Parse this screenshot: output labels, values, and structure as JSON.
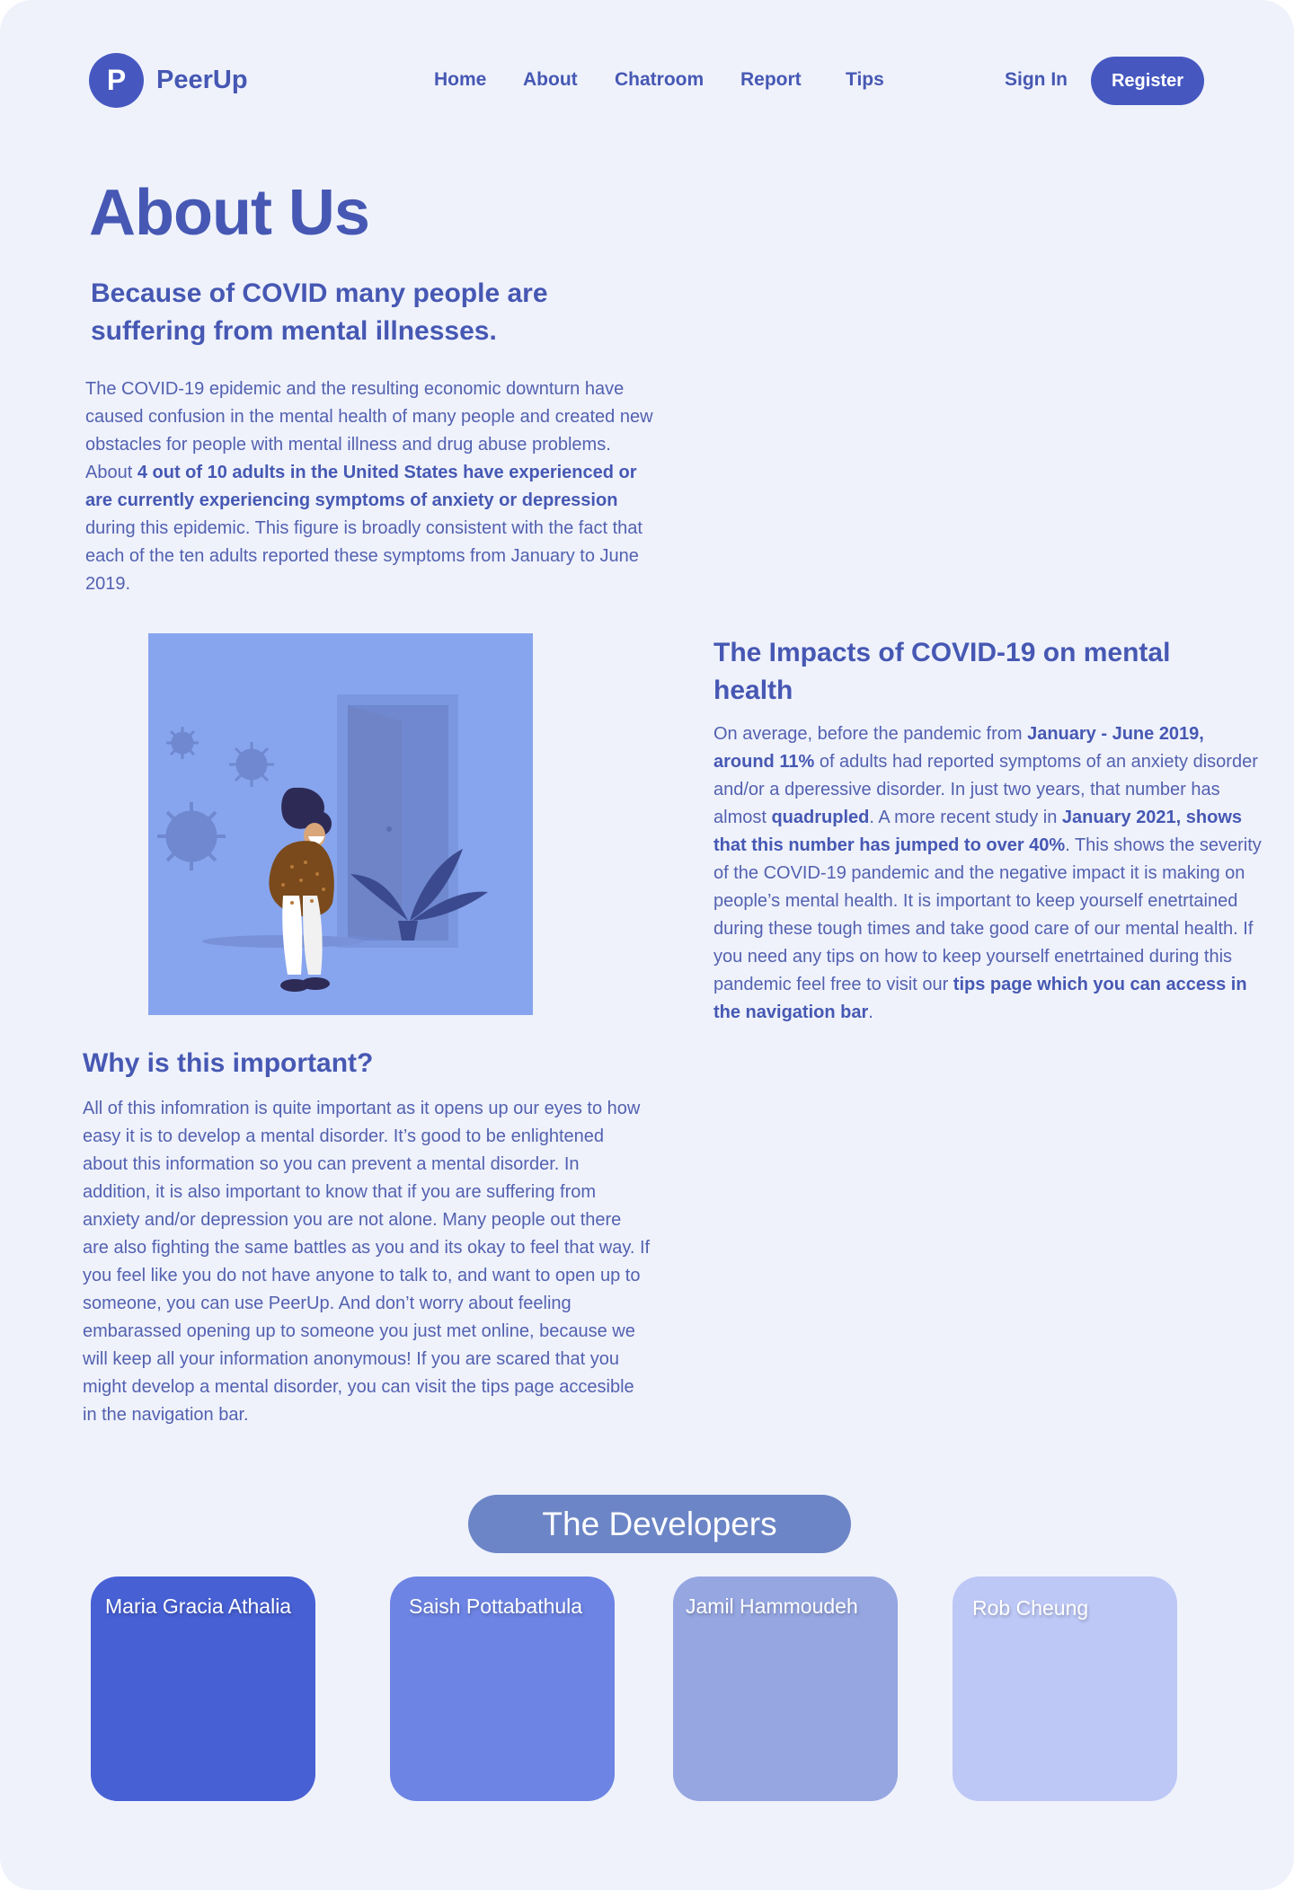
{
  "brand": {
    "logo_letter": "P",
    "name": "PeerUp",
    "color": "#4658c0"
  },
  "nav": {
    "links": [
      "Home",
      "About",
      "Chatroom",
      "Report",
      "Tips"
    ],
    "sign_in": "Sign In",
    "register": "Register"
  },
  "hero": {
    "title": "About Us",
    "subtitle": "Because of COVID many people are suffering from mental illnesses.",
    "intro": {
      "p1": "The COVID-19 epidemic and the resulting economic downturn have caused confusion in the mental health of many people and created new obstacles for people with mental illness and drug abuse problems. About ",
      "b1": "4 out of 10 adults in the United States have experienced or are currently experiencing symptoms of anxiety or depression",
      "p2": " during this epidemic. This figure is broadly consistent with the fact that each of the ten adults reported these symptoms from January to June 2019."
    }
  },
  "impacts": {
    "title": "The Impacts of COVID-19 on mental health",
    "t1": "On average, before the pandemic from ",
    "b1": "January - June 2019, around 11%",
    "t2": " of adults had reported symptoms of an anxiety disorder and/or a dperessive disorder. In just two years, that number has almost ",
    "b2": "quadrupled",
    "t3": ". A more recent study in ",
    "b3": "January 2021, shows that this number has jumped to over 40%",
    "t4": ".  This shows the severity of the COVID-19 pandemic and the negative impact it is making on people’s mental health. It is important to keep yourself enetrtained during these tough times and take good care of our mental health. If you need any tips on how to keep yourself enetrtained during this pandemic feel free to visit our ",
    "b4": "tips page which you can access in the navigation bar",
    "t5": "."
  },
  "why": {
    "title": "Why is this important?",
    "body": "All of this infomration is quite important as it opens up our eyes to how easy it is to develop a mental disorder. It’s good to be enlightened about this information so you can prevent a mental disorder. In addition, it is also important to know that if you are suffering from anxiety and/or depression you are not alone. Many people out there are also fighting the same battles as you and its okay to feel that way. If you feel like you do not have anyone to talk to, and want to open up to someone, you can use PeerUp. And don’t worry about feeling embarassed opening up to someone you just met online, because we will keep all your information anonymous! If you are scared that you might develop a mental disorder, you can visit the tips page accesible in the navigation bar."
  },
  "developers": {
    "title": "The Developers",
    "members": [
      {
        "name": "Maria Gracia Athalia",
        "color": "#4760d4"
      },
      {
        "name": "Saish Pottabathula",
        "color": "#6d84e4"
      },
      {
        "name": "Jamil Hammoudeh",
        "color": "#95a6e1"
      },
      {
        "name": "Rob Cheung",
        "color": "#bdc8f6"
      }
    ]
  },
  "illustration": {
    "icon": "person-with-mask-by-door-illustration"
  }
}
